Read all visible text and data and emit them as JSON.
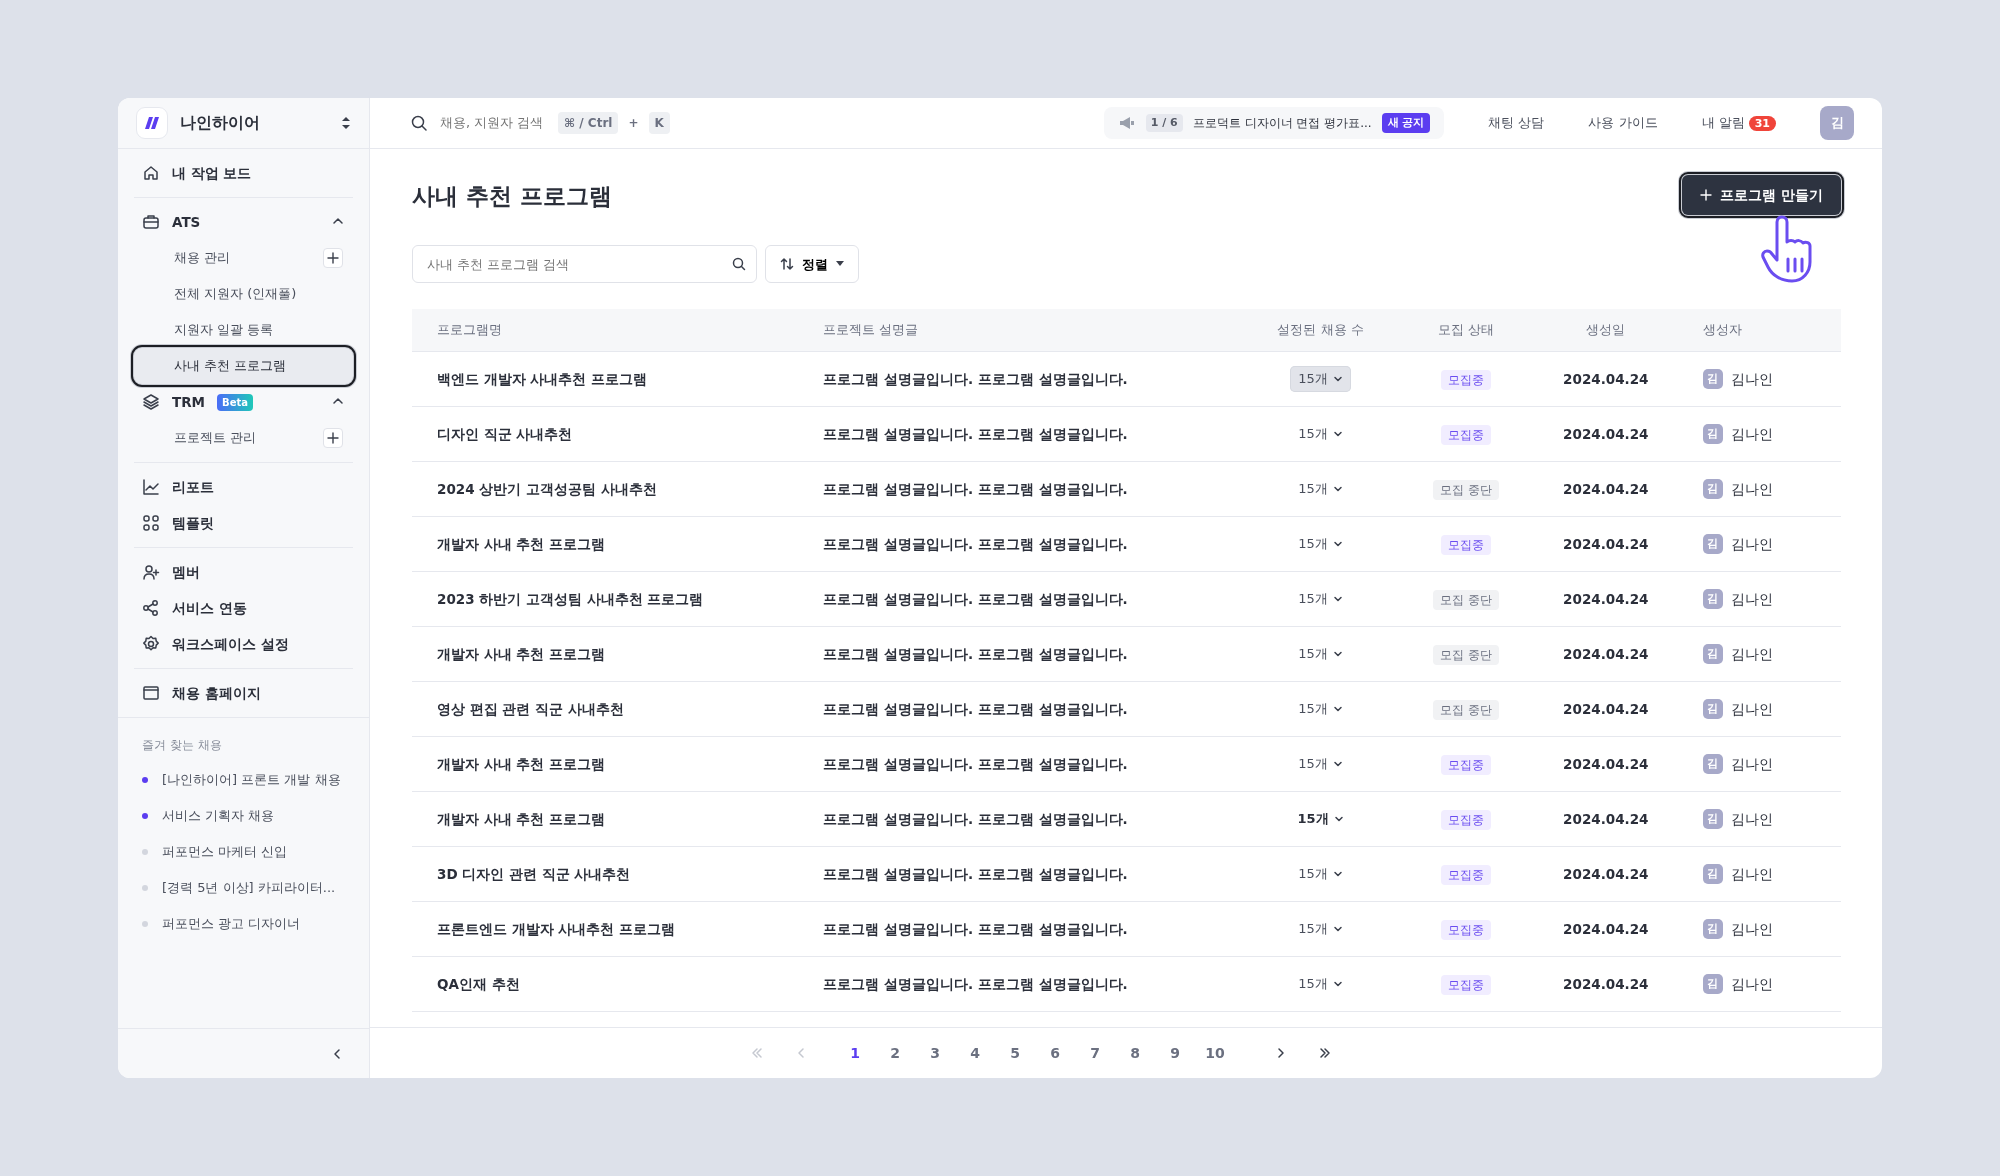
{
  "sidebar": {
    "workspace": "나인하이어",
    "groups": [
      [
        {
          "label": "내 작업 보드"
        }
      ],
      [
        {
          "label": "ATS",
          "expanded": true,
          "children": [
            {
              "label": "채용 관리",
              "add": true,
              "selected": false
            },
            {
              "label": "전체 지원자 (인재풀)",
              "add": false,
              "selected": false
            },
            {
              "label": "지원자 일괄 등록",
              "add": false,
              "selected": false
            },
            {
              "label": "사내 추천 프로그램",
              "add": false,
              "selected": true
            }
          ]
        },
        {
          "label": "TRM",
          "badge": "Beta",
          "expanded": true,
          "children": [
            {
              "label": "프로젝트 관리",
              "add": true,
              "selected": false
            }
          ]
        }
      ],
      [
        {
          "label": "리포트"
        },
        {
          "label": "템플릿"
        }
      ],
      [
        {
          "label": "멤버"
        },
        {
          "label": "서비스 연동"
        },
        {
          "label": "워크스페이스 설정"
        }
      ],
      [
        {
          "label": "채용 홈페이지"
        }
      ]
    ],
    "favorites_title": "즐겨 찾는 채용",
    "favorites": [
      {
        "label": "[나인하이어] 프론트 개발 채용",
        "color": "#5b3df0"
      },
      {
        "label": "서비스 기획자 채용",
        "color": "#5b3df0"
      },
      {
        "label": "퍼포먼스 마케터 신입",
        "color": "#d3d6de"
      },
      {
        "label": "[경력 5년 이상] 카피라이터...",
        "color": "#d3d6de"
      },
      {
        "label": "퍼포먼스 광고 디자이너",
        "color": "#d3d6de"
      }
    ]
  },
  "topbar": {
    "search_placeholder": "채용, 지원자 검색",
    "shortcut": [
      "⌘ / Ctrl",
      "+",
      "K"
    ],
    "notice": {
      "counter": "1 / 6",
      "text": "프로덕트 디자이너 면접 평가표...",
      "badge": "새 공지"
    },
    "links": [
      "채팅 상담",
      "사용 가이드"
    ],
    "alerts": {
      "label": "내 알림",
      "count": "31"
    },
    "avatar": "김"
  },
  "page": {
    "title": "사내 추천 프로그램",
    "create_button": "프로그램 만들기",
    "search_placeholder": "사내 추천 프로그램 검색",
    "sort_button": "정렬"
  },
  "table": {
    "columns": [
      "프로그램명",
      "프로젝트 설명글",
      "설정된 채용 수",
      "모집 상태",
      "생성일",
      "생성자"
    ],
    "rows": [
      {
        "name": "백엔드 개발자 사내추천 프로그램",
        "description": "프로그램 설명글입니다. 프로그램 설명글입니다.",
        "count": "15개",
        "count_highlighted": true,
        "count_bold": false,
        "status": "모집중",
        "recruiting": true,
        "date": "2024.04.24",
        "avatar": "김",
        "creator": "김나인"
      },
      {
        "name": "디자인 직군 사내추천",
        "description": "프로그램 설명글입니다. 프로그램 설명글입니다.",
        "count": "15개",
        "count_highlighted": false,
        "count_bold": false,
        "status": "모집중",
        "recruiting": true,
        "date": "2024.04.24",
        "avatar": "김",
        "creator": "김나인"
      },
      {
        "name": "2024 상반기 고객성공팀 사내추천",
        "description": "프로그램 설명글입니다. 프로그램 설명글입니다.",
        "count": "15개",
        "count_highlighted": false,
        "count_bold": false,
        "status": "모집 중단",
        "recruiting": false,
        "date": "2024.04.24",
        "avatar": "김",
        "creator": "김나인"
      },
      {
        "name": "개발자 사내 추천 프로그램",
        "description": "프로그램 설명글입니다. 프로그램 설명글입니다.",
        "count": "15개",
        "count_highlighted": false,
        "count_bold": false,
        "status": "모집중",
        "recruiting": true,
        "date": "2024.04.24",
        "avatar": "김",
        "creator": "김나인"
      },
      {
        "name": "2023 하반기 고객성팀 사내추천 프로그램",
        "description": "프로그램 설명글입니다. 프로그램 설명글입니다.",
        "count": "15개",
        "count_highlighted": false,
        "count_bold": false,
        "status": "모집 중단",
        "recruiting": false,
        "date": "2024.04.24",
        "avatar": "김",
        "creator": "김나인"
      },
      {
        "name": "개발자 사내 추천 프로그램",
        "description": "프로그램 설명글입니다. 프로그램 설명글입니다.",
        "count": "15개",
        "count_highlighted": false,
        "count_bold": false,
        "status": "모집 중단",
        "recruiting": false,
        "date": "2024.04.24",
        "avatar": "김",
        "creator": "김나인"
      },
      {
        "name": "영상 편집 관련 직군 사내추천",
        "description": "프로그램 설명글입니다. 프로그램 설명글입니다.",
        "count": "15개",
        "count_highlighted": false,
        "count_bold": false,
        "status": "모집 중단",
        "recruiting": false,
        "date": "2024.04.24",
        "avatar": "김",
        "creator": "김나인"
      },
      {
        "name": "개발자 사내 추천 프로그램",
        "description": "프로그램 설명글입니다. 프로그램 설명글입니다.",
        "count": "15개",
        "count_highlighted": false,
        "count_bold": false,
        "status": "모집중",
        "recruiting": true,
        "date": "2024.04.24",
        "avatar": "김",
        "creator": "김나인"
      },
      {
        "name": "개발자 사내 추천 프로그램",
        "description": "프로그램 설명글입니다. 프로그램 설명글입니다.",
        "count": "15개",
        "count_highlighted": false,
        "count_bold": true,
        "status": "모집중",
        "recruiting": true,
        "date": "2024.04.24",
        "avatar": "김",
        "creator": "김나인"
      },
      {
        "name": "3D 디자인 관련 직군 사내추천",
        "description": "프로그램 설명글입니다. 프로그램 설명글입니다.",
        "count": "15개",
        "count_highlighted": false,
        "count_bold": false,
        "status": "모집중",
        "recruiting": true,
        "date": "2024.04.24",
        "avatar": "김",
        "creator": "김나인"
      },
      {
        "name": "프론트엔드 개발자 사내추천 프로그램",
        "description": "프로그램 설명글입니다. 프로그램 설명글입니다.",
        "count": "15개",
        "count_highlighted": false,
        "count_bold": false,
        "status": "모집중",
        "recruiting": true,
        "date": "2024.04.24",
        "avatar": "김",
        "creator": "김나인"
      },
      {
        "name": "QA인재 추천",
        "description": "프로그램 설명글입니다. 프로그램 설명글입니다.",
        "count": "15개",
        "count_highlighted": false,
        "count_bold": false,
        "status": "모집중",
        "recruiting": true,
        "date": "2024.04.24",
        "avatar": "김",
        "creator": "김나인"
      }
    ]
  },
  "pagination": {
    "first_disabled": true,
    "prev_disabled": true,
    "pages": [
      {
        "label": "1",
        "selected": true
      },
      {
        "label": "2",
        "selected": false
      },
      {
        "label": "3",
        "selected": false
      },
      {
        "label": "4",
        "selected": false
      },
      {
        "label": "5",
        "selected": false
      },
      {
        "label": "6",
        "selected": false
      },
      {
        "label": "7",
        "selected": false
      },
      {
        "label": "8",
        "selected": false
      },
      {
        "label": "9",
        "selected": false
      },
      {
        "label": "10",
        "selected": false
      }
    ]
  }
}
